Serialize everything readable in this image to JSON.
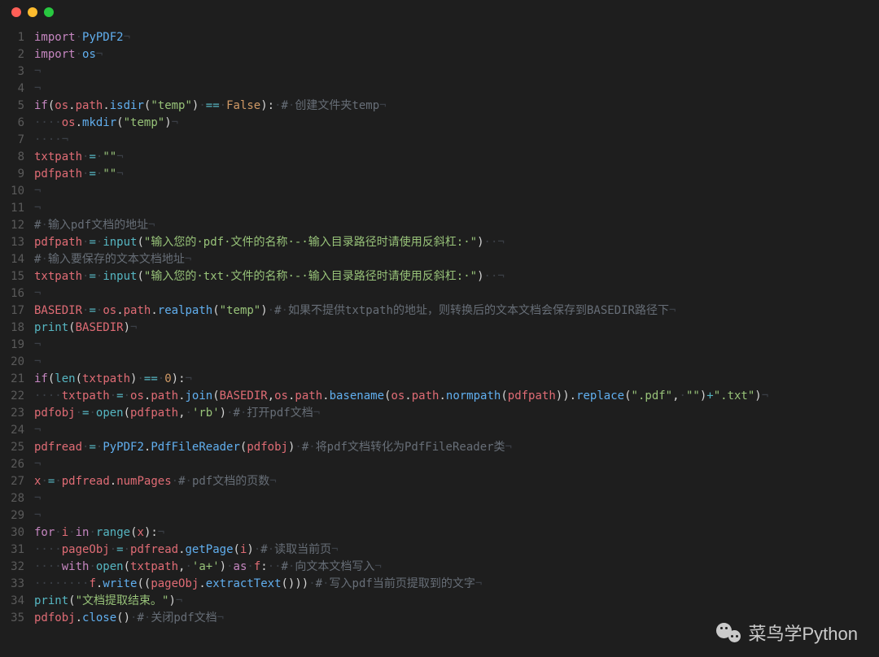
{
  "window": {
    "traffic_lights": [
      "close",
      "minimize",
      "zoom"
    ]
  },
  "watermark": {
    "icon": "wechat-icon",
    "text": "菜鸟学Python"
  },
  "code_lines": [
    {
      "n": 1,
      "tokens": [
        [
          "kw",
          "import"
        ],
        [
          "ws",
          "·"
        ],
        [
          "cls",
          "PyPDF2"
        ],
        [
          "cr",
          "¬"
        ]
      ]
    },
    {
      "n": 2,
      "tokens": [
        [
          "kw",
          "import"
        ],
        [
          "ws",
          "·"
        ],
        [
          "cls",
          "os"
        ],
        [
          "cr",
          "¬"
        ]
      ]
    },
    {
      "n": 3,
      "tokens": [
        [
          "cr",
          "¬"
        ]
      ]
    },
    {
      "n": 4,
      "tokens": [
        [
          "cr",
          "¬"
        ]
      ]
    },
    {
      "n": 5,
      "tokens": [
        [
          "kw",
          "if"
        ],
        [
          "pun",
          "("
        ],
        [
          "var",
          "os"
        ],
        [
          "pun",
          "."
        ],
        [
          "var",
          "path"
        ],
        [
          "pun",
          "."
        ],
        [
          "fn2",
          "isdir"
        ],
        [
          "pun",
          "("
        ],
        [
          "str",
          "\"temp\""
        ],
        [
          "pun",
          ")"
        ],
        [
          "ws",
          "·"
        ],
        [
          "op",
          "=="
        ],
        [
          "ws",
          "·"
        ],
        [
          "const",
          "False"
        ],
        [
          "pun",
          "):"
        ],
        [
          "ws",
          "·"
        ],
        [
          "cmt",
          "#"
        ],
        [
          "ws",
          "·"
        ],
        [
          "cmt",
          "创建文件夹temp"
        ],
        [
          "cr",
          "¬"
        ]
      ]
    },
    {
      "n": 6,
      "tokens": [
        [
          "ws",
          "····"
        ],
        [
          "var",
          "os"
        ],
        [
          "pun",
          "."
        ],
        [
          "fn2",
          "mkdir"
        ],
        [
          "pun",
          "("
        ],
        [
          "str",
          "\"temp\""
        ],
        [
          "pun",
          ")"
        ],
        [
          "cr",
          "¬"
        ]
      ]
    },
    {
      "n": 7,
      "tokens": [
        [
          "ws",
          "····"
        ],
        [
          "cr",
          "¬"
        ]
      ]
    },
    {
      "n": 8,
      "tokens": [
        [
          "var",
          "txtpath"
        ],
        [
          "ws",
          "·"
        ],
        [
          "op",
          "="
        ],
        [
          "ws",
          "·"
        ],
        [
          "str",
          "\"\""
        ],
        [
          "cr",
          "¬"
        ]
      ]
    },
    {
      "n": 9,
      "tokens": [
        [
          "var",
          "pdfpath"
        ],
        [
          "ws",
          "·"
        ],
        [
          "op",
          "="
        ],
        [
          "ws",
          "·"
        ],
        [
          "str",
          "\"\""
        ],
        [
          "cr",
          "¬"
        ]
      ]
    },
    {
      "n": 10,
      "tokens": [
        [
          "cr",
          "¬"
        ]
      ]
    },
    {
      "n": 11,
      "tokens": [
        [
          "cr",
          "¬"
        ]
      ]
    },
    {
      "n": 12,
      "tokens": [
        [
          "cmt",
          "#"
        ],
        [
          "ws",
          "·"
        ],
        [
          "cmt",
          "输入pdf文档的地址"
        ],
        [
          "cr",
          "¬"
        ]
      ]
    },
    {
      "n": 13,
      "tokens": [
        [
          "var",
          "pdfpath"
        ],
        [
          "ws",
          "·"
        ],
        [
          "op",
          "="
        ],
        [
          "ws",
          "·"
        ],
        [
          "fn",
          "input"
        ],
        [
          "pun",
          "("
        ],
        [
          "str",
          "\"输入您的·pdf·文件的名称·-·输入目录路径时请使用反斜杠:·\""
        ],
        [
          "pun",
          ")"
        ],
        [
          "ws",
          "··"
        ],
        [
          "cr",
          "¬"
        ]
      ]
    },
    {
      "n": 14,
      "tokens": [
        [
          "cmt",
          "#"
        ],
        [
          "ws",
          "·"
        ],
        [
          "cmt",
          "输入要保存的文本文档地址"
        ],
        [
          "cr",
          "¬"
        ]
      ]
    },
    {
      "n": 15,
      "tokens": [
        [
          "var",
          "txtpath"
        ],
        [
          "ws",
          "·"
        ],
        [
          "op",
          "="
        ],
        [
          "ws",
          "·"
        ],
        [
          "fn",
          "input"
        ],
        [
          "pun",
          "("
        ],
        [
          "str",
          "\"输入您的·txt·文件的名称·-·输入目录路径时请使用反斜杠:·\""
        ],
        [
          "pun",
          ")"
        ],
        [
          "ws",
          "··"
        ],
        [
          "cr",
          "¬"
        ]
      ]
    },
    {
      "n": 16,
      "tokens": [
        [
          "cr",
          "¬"
        ]
      ]
    },
    {
      "n": 17,
      "tokens": [
        [
          "var",
          "BASEDIR"
        ],
        [
          "ws",
          "·"
        ],
        [
          "op",
          "="
        ],
        [
          "ws",
          "·"
        ],
        [
          "var",
          "os"
        ],
        [
          "pun",
          "."
        ],
        [
          "var",
          "path"
        ],
        [
          "pun",
          "."
        ],
        [
          "fn2",
          "realpath"
        ],
        [
          "pun",
          "("
        ],
        [
          "str",
          "\"temp\""
        ],
        [
          "pun",
          ")"
        ],
        [
          "ws",
          "·"
        ],
        [
          "cmt",
          "#"
        ],
        [
          "ws",
          "·"
        ],
        [
          "cmt",
          "如果不提供txtpath的地址，则转换后的文本文档会保存到BASEDIR路径下"
        ],
        [
          "cr",
          "¬"
        ]
      ]
    },
    {
      "n": 18,
      "tokens": [
        [
          "fn",
          "print"
        ],
        [
          "pun",
          "("
        ],
        [
          "var",
          "BASEDIR"
        ],
        [
          "pun",
          ")"
        ],
        [
          "cr",
          "¬"
        ]
      ]
    },
    {
      "n": 19,
      "tokens": [
        [
          "cr",
          "¬"
        ]
      ]
    },
    {
      "n": 20,
      "tokens": [
        [
          "cr",
          "¬"
        ]
      ]
    },
    {
      "n": 21,
      "tokens": [
        [
          "kw",
          "if"
        ],
        [
          "pun",
          "("
        ],
        [
          "fn",
          "len"
        ],
        [
          "pun",
          "("
        ],
        [
          "var",
          "txtpath"
        ],
        [
          "pun",
          ")"
        ],
        [
          "ws",
          "·"
        ],
        [
          "op",
          "=="
        ],
        [
          "ws",
          "·"
        ],
        [
          "num",
          "0"
        ],
        [
          "pun",
          "):"
        ],
        [
          "cr",
          "¬"
        ]
      ]
    },
    {
      "n": 22,
      "tokens": [
        [
          "ws",
          "····"
        ],
        [
          "var",
          "txtpath"
        ],
        [
          "ws",
          "·"
        ],
        [
          "op",
          "="
        ],
        [
          "ws",
          "·"
        ],
        [
          "var",
          "os"
        ],
        [
          "pun",
          "."
        ],
        [
          "var",
          "path"
        ],
        [
          "pun",
          "."
        ],
        [
          "fn2",
          "join"
        ],
        [
          "pun",
          "("
        ],
        [
          "var",
          "BASEDIR"
        ],
        [
          "pun",
          ","
        ],
        [
          "var",
          "os"
        ],
        [
          "pun",
          "."
        ],
        [
          "var",
          "path"
        ],
        [
          "pun",
          "."
        ],
        [
          "fn2",
          "basename"
        ],
        [
          "pun",
          "("
        ],
        [
          "var",
          "os"
        ],
        [
          "pun",
          "."
        ],
        [
          "var",
          "path"
        ],
        [
          "pun",
          "."
        ],
        [
          "fn2",
          "normpath"
        ],
        [
          "pun",
          "("
        ],
        [
          "var",
          "pdfpath"
        ],
        [
          "pun",
          "))."
        ],
        [
          "fn2",
          "replace"
        ],
        [
          "pun",
          "("
        ],
        [
          "str",
          "\".pdf\""
        ],
        [
          "pun",
          ","
        ],
        [
          "ws",
          "·"
        ],
        [
          "str",
          "\"\""
        ],
        [
          "pun",
          ")"
        ],
        [
          "op",
          "+"
        ],
        [
          "str",
          "\".txt\""
        ],
        [
          "pun",
          ")"
        ],
        [
          "cr",
          "¬"
        ]
      ]
    },
    {
      "n": 23,
      "tokens": [
        [
          "var",
          "pdfobj"
        ],
        [
          "ws",
          "·"
        ],
        [
          "op",
          "="
        ],
        [
          "ws",
          "·"
        ],
        [
          "fn",
          "open"
        ],
        [
          "pun",
          "("
        ],
        [
          "var",
          "pdfpath"
        ],
        [
          "pun",
          ","
        ],
        [
          "ws",
          "·"
        ],
        [
          "str",
          "'rb'"
        ],
        [
          "pun",
          ")"
        ],
        [
          "ws",
          "·"
        ],
        [
          "cmt",
          "#"
        ],
        [
          "ws",
          "·"
        ],
        [
          "cmt",
          "打开pdf文档"
        ],
        [
          "cr",
          "¬"
        ]
      ]
    },
    {
      "n": 24,
      "tokens": [
        [
          "cr",
          "¬"
        ]
      ]
    },
    {
      "n": 25,
      "tokens": [
        [
          "var",
          "pdfread"
        ],
        [
          "ws",
          "·"
        ],
        [
          "op",
          "="
        ],
        [
          "ws",
          "·"
        ],
        [
          "cls",
          "PyPDF2"
        ],
        [
          "pun",
          "."
        ],
        [
          "fn2",
          "PdfFileReader"
        ],
        [
          "pun",
          "("
        ],
        [
          "var",
          "pdfobj"
        ],
        [
          "pun",
          ")"
        ],
        [
          "ws",
          "·"
        ],
        [
          "cmt",
          "#"
        ],
        [
          "ws",
          "·"
        ],
        [
          "cmt",
          "将pdf文档转化为PdfFileReader类"
        ],
        [
          "cr",
          "¬"
        ]
      ]
    },
    {
      "n": 26,
      "tokens": [
        [
          "cr",
          "¬"
        ]
      ]
    },
    {
      "n": 27,
      "tokens": [
        [
          "var",
          "x"
        ],
        [
          "ws",
          "·"
        ],
        [
          "op",
          "="
        ],
        [
          "ws",
          "·"
        ],
        [
          "var",
          "pdfread"
        ],
        [
          "pun",
          "."
        ],
        [
          "attr",
          "numPages"
        ],
        [
          "ws",
          "·"
        ],
        [
          "cmt",
          "#"
        ],
        [
          "ws",
          "·"
        ],
        [
          "cmt",
          "pdf文档的页数"
        ],
        [
          "cr",
          "¬"
        ]
      ]
    },
    {
      "n": 28,
      "tokens": [
        [
          "cr",
          "¬"
        ]
      ]
    },
    {
      "n": 29,
      "tokens": [
        [
          "cr",
          "¬"
        ]
      ]
    },
    {
      "n": 30,
      "tokens": [
        [
          "kw",
          "for"
        ],
        [
          "ws",
          "·"
        ],
        [
          "var",
          "i"
        ],
        [
          "ws",
          "·"
        ],
        [
          "kw",
          "in"
        ],
        [
          "ws",
          "·"
        ],
        [
          "fn",
          "range"
        ],
        [
          "pun",
          "("
        ],
        [
          "var",
          "x"
        ],
        [
          "pun",
          "):"
        ],
        [
          "cr",
          "¬"
        ]
      ]
    },
    {
      "n": 31,
      "tokens": [
        [
          "ws",
          "····"
        ],
        [
          "var",
          "pageObj"
        ],
        [
          "ws",
          "·"
        ],
        [
          "op",
          "="
        ],
        [
          "ws",
          "·"
        ],
        [
          "var",
          "pdfread"
        ],
        [
          "pun",
          "."
        ],
        [
          "fn2",
          "getPage"
        ],
        [
          "pun",
          "("
        ],
        [
          "var",
          "i"
        ],
        [
          "pun",
          ")"
        ],
        [
          "ws",
          "·"
        ],
        [
          "cmt",
          "#"
        ],
        [
          "ws",
          "·"
        ],
        [
          "cmt",
          "读取当前页"
        ],
        [
          "cr",
          "¬"
        ]
      ]
    },
    {
      "n": 32,
      "tokens": [
        [
          "ws",
          "····"
        ],
        [
          "kw",
          "with"
        ],
        [
          "ws",
          "·"
        ],
        [
          "fn",
          "open"
        ],
        [
          "pun",
          "("
        ],
        [
          "var",
          "txtpath"
        ],
        [
          "pun",
          ","
        ],
        [
          "ws",
          "·"
        ],
        [
          "str",
          "'a+'"
        ],
        [
          "pun",
          ")"
        ],
        [
          "ws",
          "·"
        ],
        [
          "kw",
          "as"
        ],
        [
          "ws",
          "·"
        ],
        [
          "var",
          "f"
        ],
        [
          "pun",
          ":"
        ],
        [
          "ws",
          "··"
        ],
        [
          "cmt",
          "#"
        ],
        [
          "ws",
          "·"
        ],
        [
          "cmt",
          "向文本文档写入"
        ],
        [
          "cr",
          "¬"
        ]
      ]
    },
    {
      "n": 33,
      "tokens": [
        [
          "ws",
          "········"
        ],
        [
          "var",
          "f"
        ],
        [
          "pun",
          "."
        ],
        [
          "fn2",
          "write"
        ],
        [
          "pun",
          "(("
        ],
        [
          "var",
          "pageObj"
        ],
        [
          "pun",
          "."
        ],
        [
          "fn2",
          "extractText"
        ],
        [
          "pun",
          "()))"
        ],
        [
          "ws",
          "·"
        ],
        [
          "cmt",
          "#"
        ],
        [
          "ws",
          "·"
        ],
        [
          "cmt",
          "写入pdf当前页提取到的文字"
        ],
        [
          "cr",
          "¬"
        ]
      ]
    },
    {
      "n": 34,
      "tokens": [
        [
          "fn",
          "print"
        ],
        [
          "pun",
          "("
        ],
        [
          "str",
          "\"文档提取结束。\""
        ],
        [
          "pun",
          ")"
        ],
        [
          "cr",
          "¬"
        ]
      ]
    },
    {
      "n": 35,
      "tokens": [
        [
          "var",
          "pdfobj"
        ],
        [
          "pun",
          "."
        ],
        [
          "fn2",
          "close"
        ],
        [
          "pun",
          "()"
        ],
        [
          "ws",
          "·"
        ],
        [
          "cmt",
          "#"
        ],
        [
          "ws",
          "·"
        ],
        [
          "cmt",
          "关闭pdf文档"
        ],
        [
          "cr",
          "¬"
        ]
      ]
    }
  ]
}
